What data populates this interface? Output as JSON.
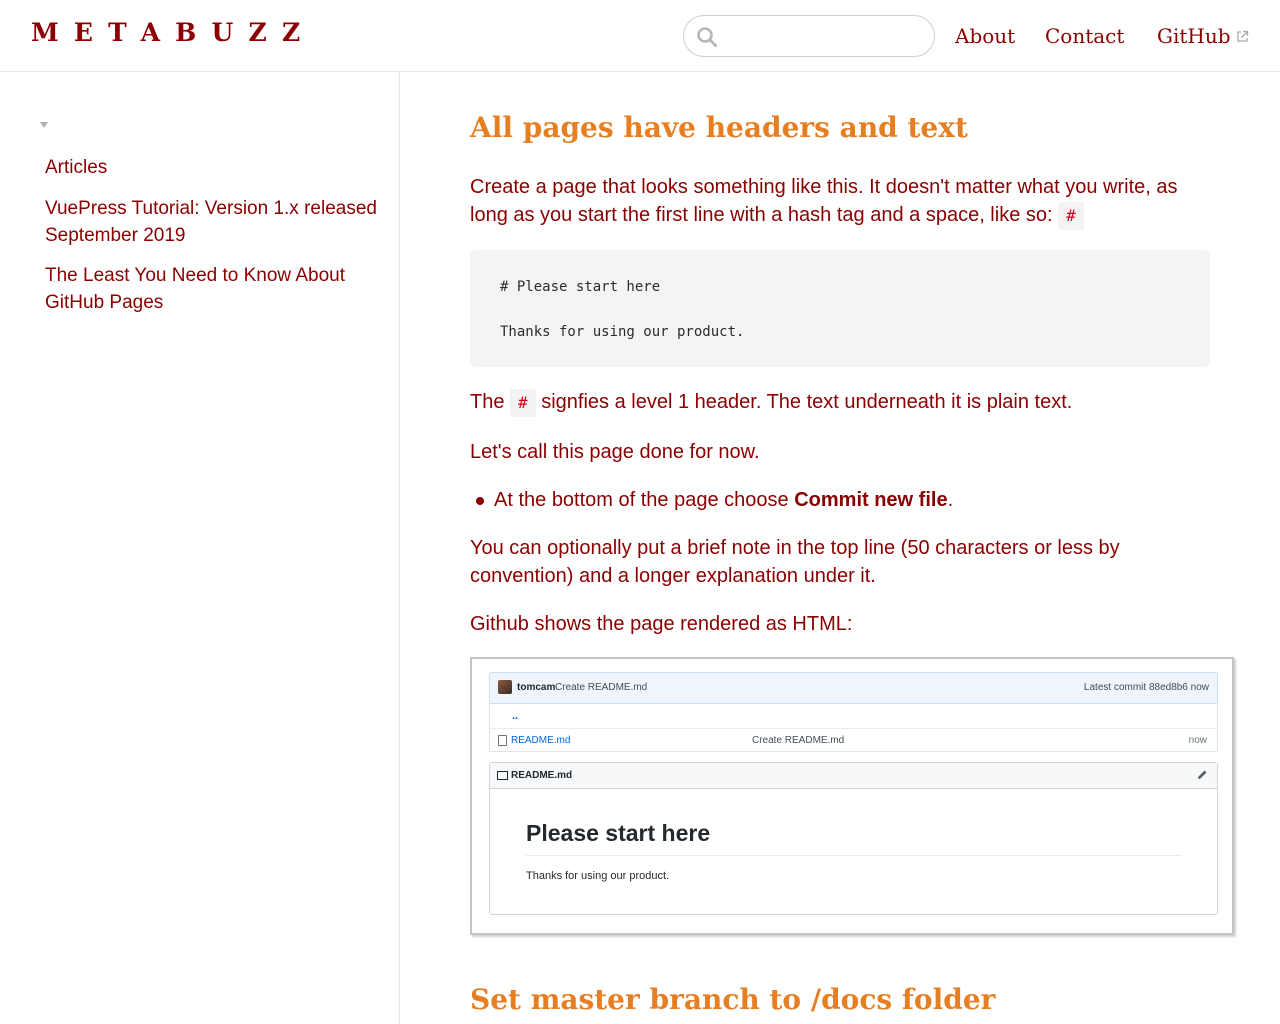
{
  "navbar": {
    "logo": "METABUZZ",
    "search": {
      "placeholder": "",
      "value": ""
    },
    "links": {
      "about": "About",
      "contact": "Contact",
      "github": "GitHub"
    },
    "icons": {
      "search": "search-icon",
      "external": "external-link-icon"
    }
  },
  "sidebar": {
    "items": [
      {
        "label": "Articles"
      },
      {
        "label": "VuePress Tutorial: Version 1.x released September 2019"
      },
      {
        "label": "The Least You Need to Know About GitHub Pages"
      }
    ]
  },
  "main": {
    "heading_1": "All pages have headers and text",
    "p1_text": "Create a page that looks something like this. It doesn't matter what you write, as long as you start the first line with a hash tag and a space, like so: ",
    "hash_code": "#",
    "code_block": {
      "line1": "# Please start here",
      "line2": "Thanks for using our product."
    },
    "p2_before": "The ",
    "p2_after": " signfies a level 1 header. The text underneath it is plain text.",
    "p3": "Let's call this page done for now.",
    "bullet_before": "At the bottom of the page choose ",
    "bullet_bold": "Commit new file",
    "bullet_after": ".",
    "p4": "You can optionally put a brief note in the top line (50 characters or less by convention) and a longer explanation under it.",
    "p5": "Github shows the page rendered as HTML:",
    "heading_2": "Set master branch to /docs folder"
  },
  "screenshot": {
    "commit_user": "tomcam",
    "commit_message": "Create README.md",
    "latest_commit": "Latest commit 88ed8b6 now",
    "updir": "..",
    "file_name": "README.md",
    "file_message": "Create README.md",
    "file_age": "now",
    "readme_title": "README.md",
    "readme_h1": "Please start here",
    "readme_p": "Thanks for using our product."
  },
  "colors": {
    "brand": "#8b0000",
    "heading": "#e67e22",
    "code_bg": "#f4f4f4",
    "inline_code": "#d0021b"
  }
}
